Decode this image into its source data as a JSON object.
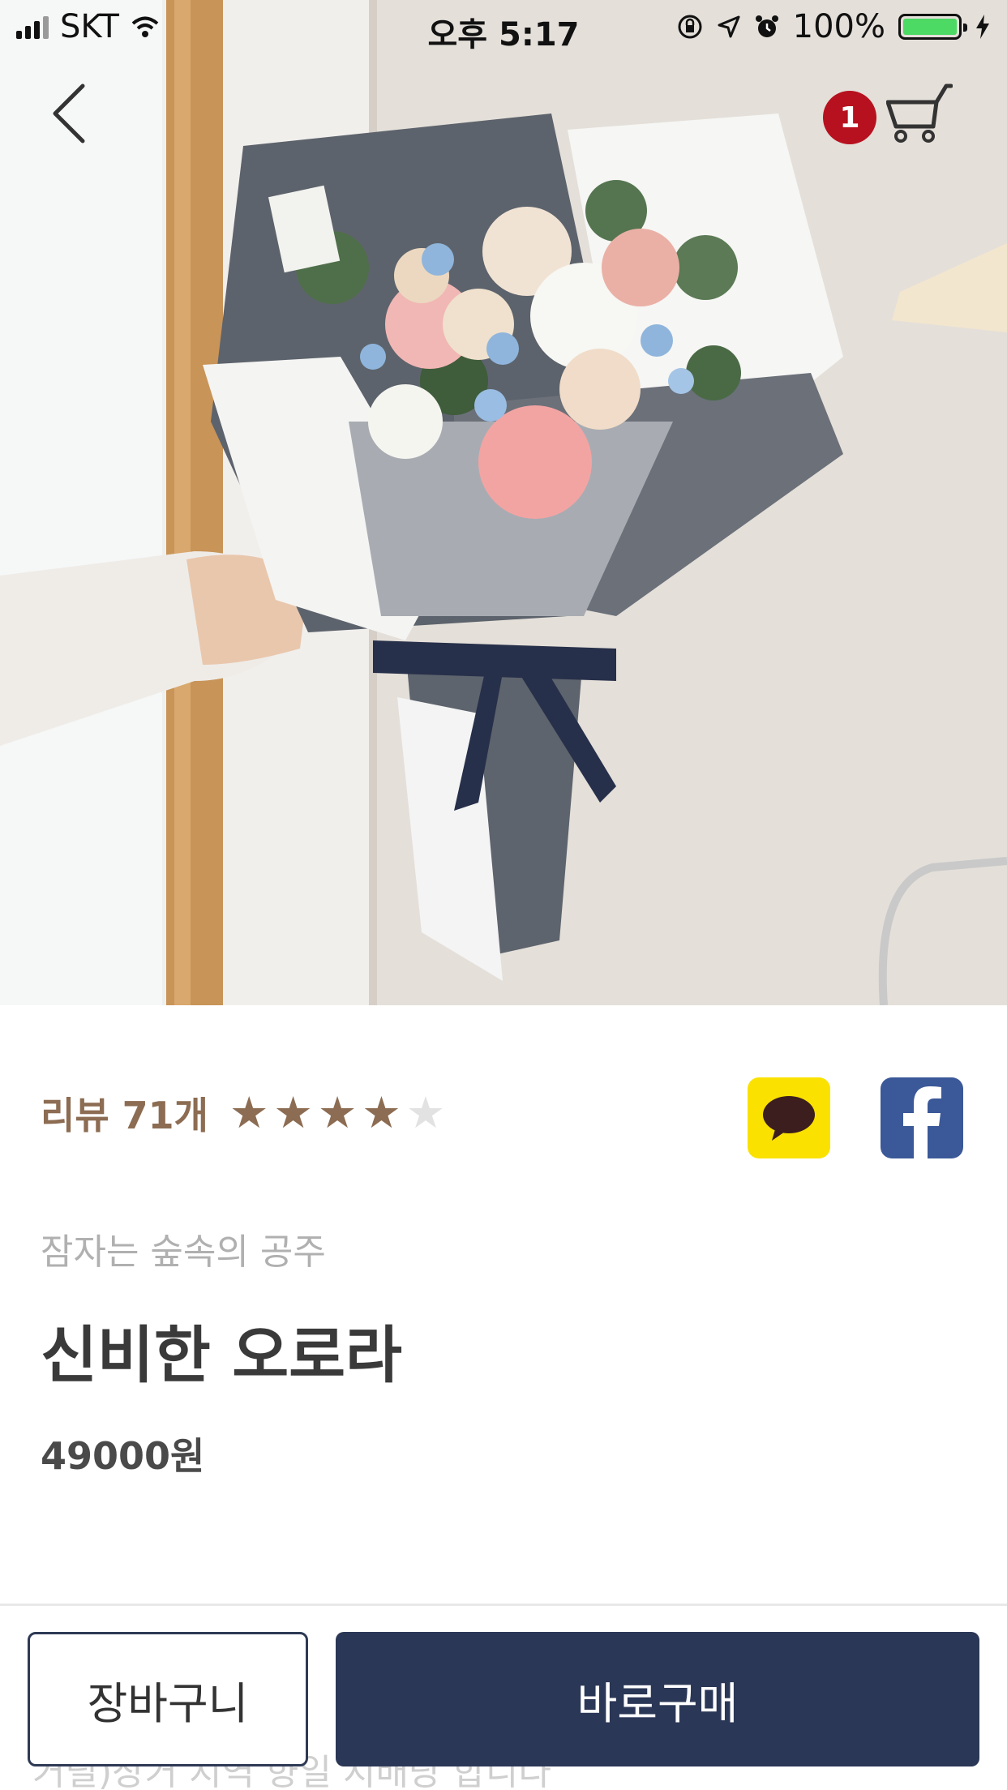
{
  "status_bar": {
    "carrier": "SKT",
    "time": "오후 5:17",
    "battery_percent": "100%",
    "battery_level": 1.0,
    "icons": [
      "signal-icon",
      "wifi-icon",
      "rotation-lock-icon",
      "location-icon",
      "alarm-icon",
      "battery-icon",
      "charging-icon"
    ]
  },
  "nav": {
    "back_icon": "chevron-left-icon",
    "cart_icon": "cart-icon",
    "cart_count": "1"
  },
  "product": {
    "image": "flower-bouquet-photo",
    "review_label": "리뷰 71개",
    "rating": 4,
    "rating_max": 5,
    "star_glyph": "★",
    "subtitle": "잠자는 숲속의 공주",
    "title": "신비한 오로라",
    "price": "49000원"
  },
  "share": {
    "kakao_icon": "kakaotalk-icon",
    "facebook_icon": "facebook-icon"
  },
  "bottom_bar": {
    "cart_button": "장바구니",
    "buy_button": "바로구매",
    "ghost_text": "거릴)장거 지역 향일 지배당 합니다"
  },
  "colors": {
    "accent": "#8c6c52",
    "primary_button": "#2b3756",
    "badge": "#b7111f",
    "kakao": "#fae100",
    "facebook": "#3b5998"
  }
}
